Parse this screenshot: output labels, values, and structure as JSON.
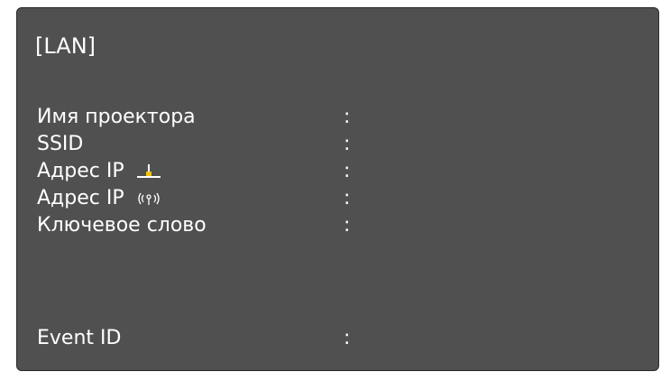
{
  "header": {
    "title": "[LAN]"
  },
  "fields": [
    {
      "label": "Имя проектора",
      "icon": "",
      "value": ""
    },
    {
      "label": "SSID",
      "icon": "",
      "value": ""
    },
    {
      "label": "Адрес IP",
      "icon": "wired-lan-icon",
      "value": ""
    },
    {
      "label": "Адрес IP",
      "icon": "wireless-lan-icon",
      "value": ""
    },
    {
      "label": "Ключевое слово",
      "icon": "",
      "value": ""
    },
    {
      "label": "Event ID",
      "icon": "",
      "value": ""
    }
  ],
  "separator": ":",
  "colors": {
    "panel_background": "#505050",
    "text": "#ffffff",
    "wired_icon_accent": "#f2c400"
  }
}
